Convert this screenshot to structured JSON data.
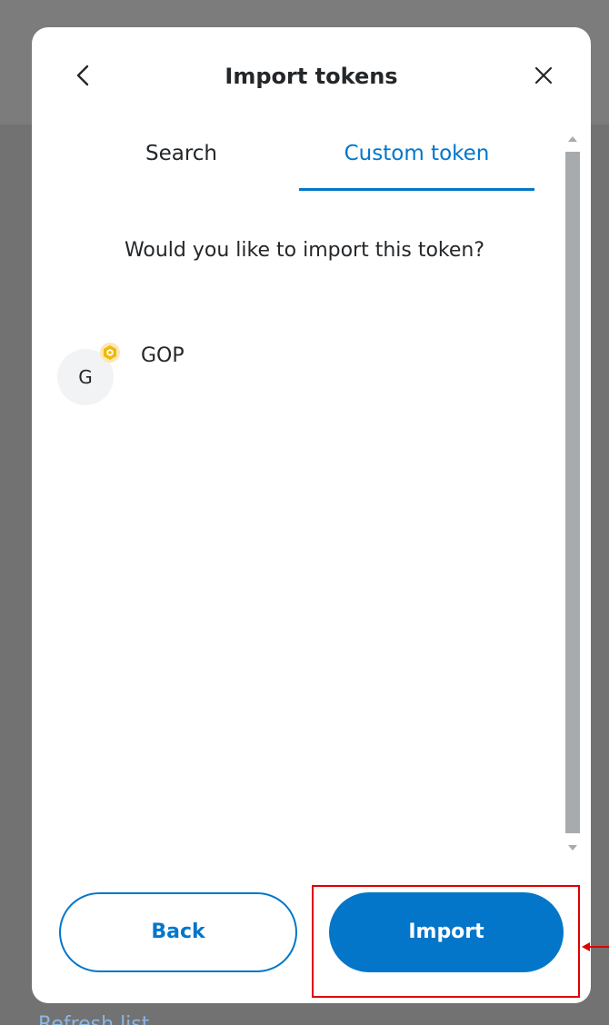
{
  "modal": {
    "title": "Import tokens",
    "tabs": [
      {
        "label": "Search",
        "active": false
      },
      {
        "label": "Custom token",
        "active": true
      }
    ],
    "prompt": "Would you like to import this token?",
    "token": {
      "letter": "G",
      "symbol": "GOP",
      "network_badge_icon": "bnb-chain-icon"
    },
    "buttons": {
      "back_label": "Back",
      "import_label": "Import"
    }
  },
  "background": {
    "partial_text": "Refresh list"
  },
  "colors": {
    "accent": "#0376c9",
    "text": "#24272a",
    "overlay": "#727272",
    "annotation": "#e00000",
    "badge": "#f0b90b"
  }
}
